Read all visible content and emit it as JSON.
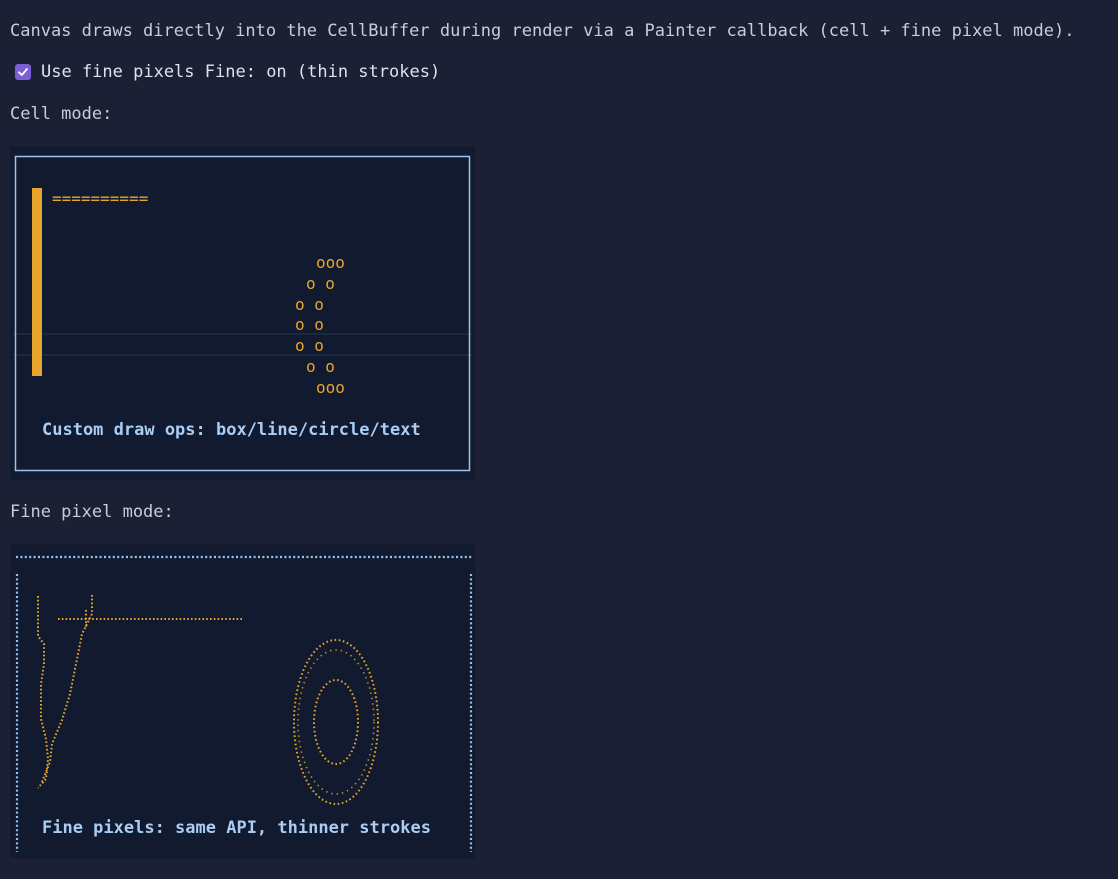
{
  "header": {
    "description": "Canvas draws directly into the CellBuffer during render via a Painter callback (cell + fine pixel mode).",
    "toggle_label": "Use fine pixels",
    "toggle_status": "Fine: on (thin strokes)",
    "toggle_checked": true
  },
  "cell_mode": {
    "heading": "Cell mode:",
    "line_text": "==========",
    "circle_rows": [
      "ooo",
      "o   o",
      "o     o",
      "o     o",
      "o     o",
      "o   o",
      "ooo"
    ],
    "caption": "Custom draw ops: box/line/circle/text"
  },
  "fine_mode": {
    "heading": "Fine pixel mode:",
    "caption": "Fine pixels: same API, thinner strokes"
  },
  "colors": {
    "background": "#1b2034",
    "panel": "#111a2e",
    "accent": "#e8a52c",
    "frame": "#9cc3f0",
    "caption": "#a9cdf5",
    "checkbox": "#7a5fd6"
  }
}
